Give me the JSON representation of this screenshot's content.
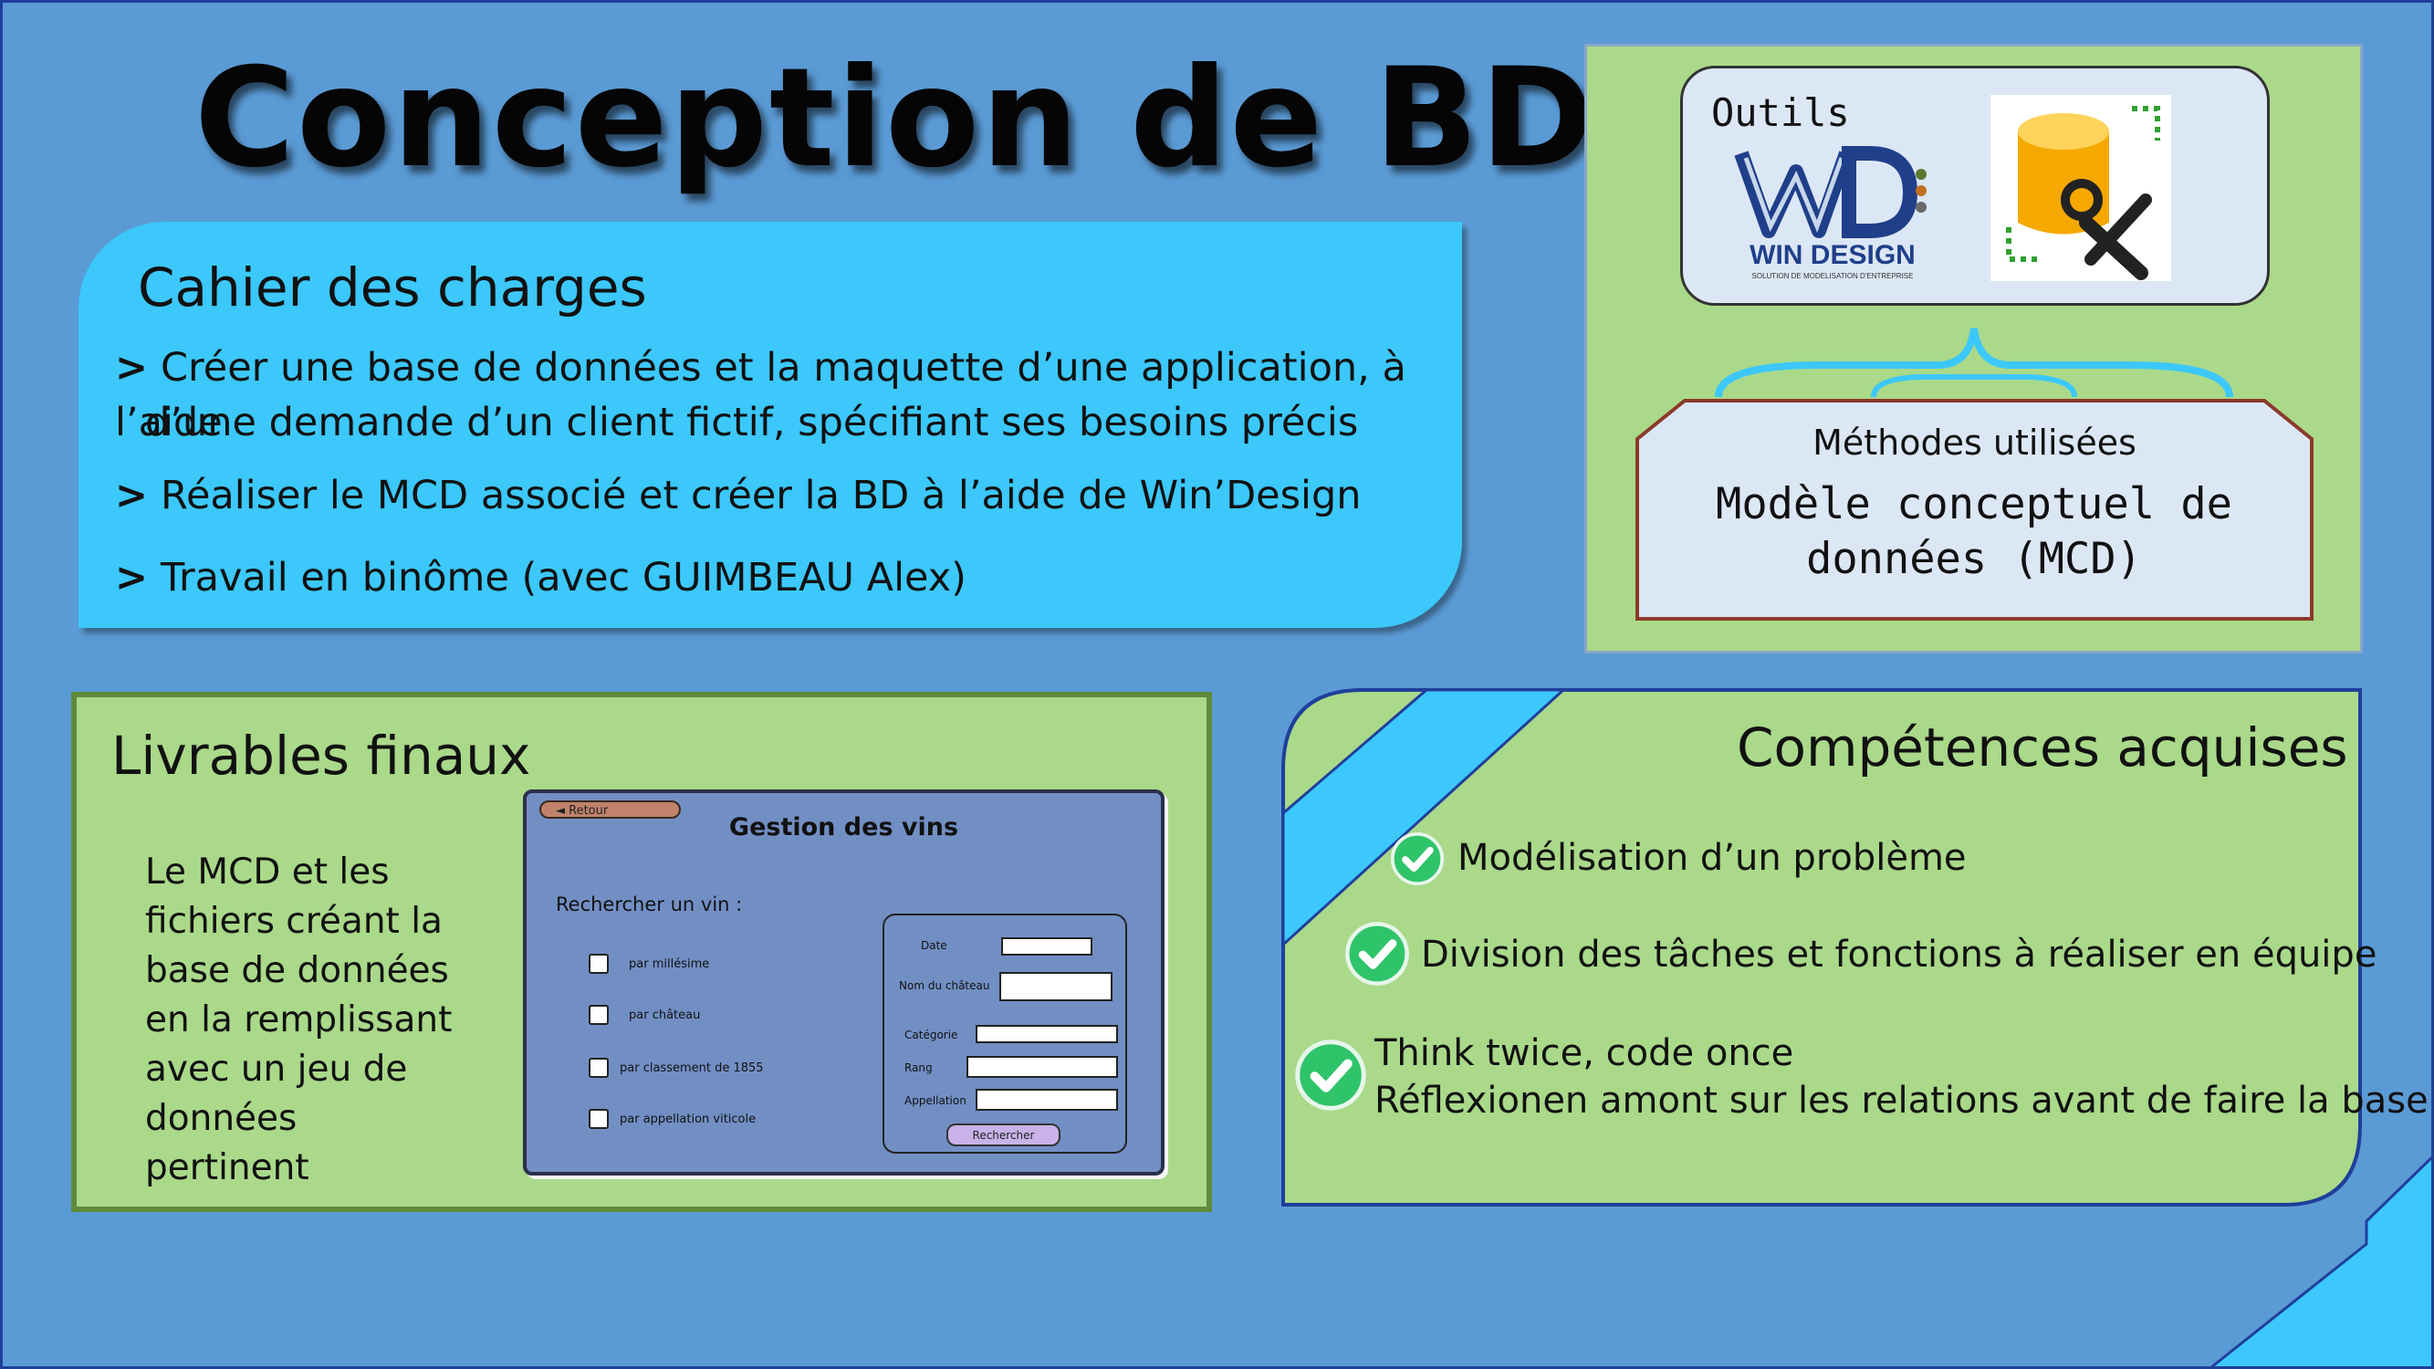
{
  "title": "Conception de BD",
  "cahier": {
    "heading": "Cahier des charges",
    "bullet_marker": ">",
    "items": [
      "Créer une base de données et la maquette d’une application, à l’aide",
      "d’une demande d’un  client fictif, spécifiant ses besoins précis",
      "Réaliser le MCD associé et créer la BD à l’aide de Win’Design",
      "Travail en binôme (avec GUIMBEAU Alex)"
    ]
  },
  "outils": {
    "label": "Outils",
    "logo_text": "WIN DESIGN",
    "logo_subtext": "SOLUTION DE MODELISATION D'ENTREPRISE",
    "icons": [
      "windesign-logo",
      "database-tools-icon"
    ]
  },
  "methodes": {
    "title": "Méthodes utilisées",
    "line1": "Modèle conceptuel de",
    "line2": "données (MCD)"
  },
  "livrables": {
    "heading": "Livrables finaux",
    "lines": [
      "Le MCD et les",
      "fichiers créant la",
      "base de données",
      "en la remplissant",
      "avec un jeu de",
      "données pertinent"
    ]
  },
  "mockup": {
    "back_button": "◄ Retour",
    "title": "Gestion des vins",
    "search_label": "Rechercher un vin :",
    "options": [
      "par millésime",
      "par château",
      "par classement de 1855",
      "par appellation viticole"
    ],
    "fields": [
      "Date",
      "Nom du château",
      "Catégorie",
      "Rang",
      "Appellation"
    ],
    "search_button": "Rechercher"
  },
  "competences": {
    "heading": "Compétences acquises",
    "items": [
      "Modélisation d’un problème",
      "Division des tâches et fonctions à réaliser en équipe",
      "Think twice, code once",
      "Réflexionen amont sur les relations avant de faire la base"
    ]
  },
  "colors": {
    "background": "#5b9bd5",
    "cyan": "#3cc8fb",
    "green_panel": "#aad98a",
    "check_green": "#2fc46a"
  }
}
